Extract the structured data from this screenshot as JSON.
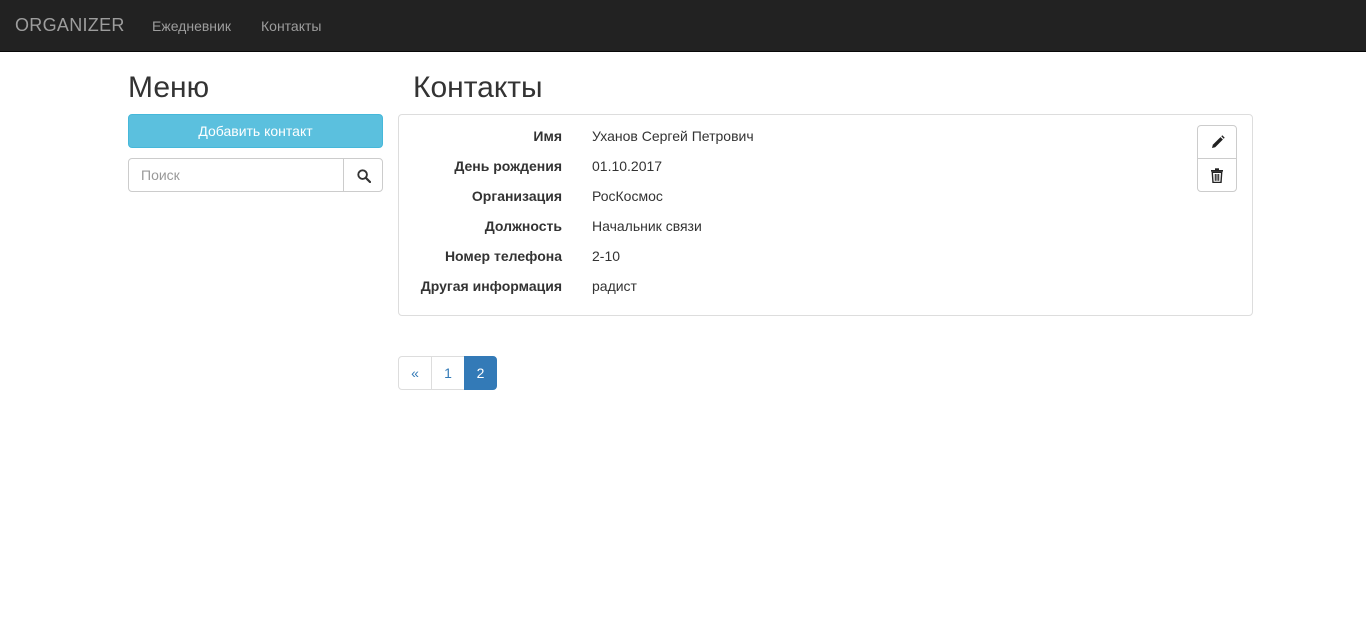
{
  "navbar": {
    "brand": "ORGANIZER",
    "links": [
      "Ежедневник",
      "Контакты"
    ]
  },
  "sidebar": {
    "title": "Меню",
    "add_button": "Добавить контакт",
    "search": {
      "placeholder": "Поиск",
      "value": ""
    }
  },
  "main": {
    "title": "Контакты",
    "contact": {
      "fields": [
        {
          "label": "Имя",
          "value": "Уханов Сергей Петрович"
        },
        {
          "label": "День рождения",
          "value": "01.10.2017"
        },
        {
          "label": "Организация",
          "value": "РосКосмос"
        },
        {
          "label": "Должность",
          "value": "Начальник связи"
        },
        {
          "label": "Номер телефона",
          "value": "2-10"
        },
        {
          "label": "Другая информация",
          "value": "радист"
        }
      ],
      "actions": [
        "pencil-icon",
        "trash-icon"
      ]
    },
    "pagination": {
      "prev": "«",
      "pages": [
        "1",
        "2"
      ],
      "active": "2"
    }
  },
  "colors": {
    "navbar_bg": "#222222",
    "info_button": "#5bc0de",
    "primary": "#337ab7"
  }
}
